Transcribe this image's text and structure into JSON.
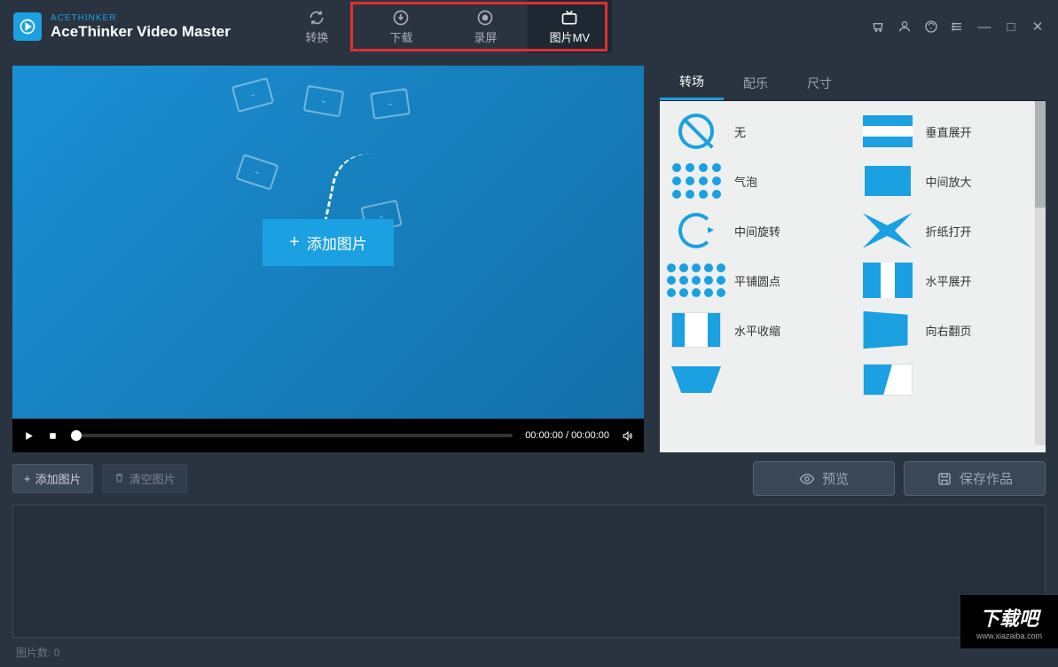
{
  "brand": {
    "top": "ACETHINKER",
    "main": "AceThinker Video Master"
  },
  "nav": {
    "convert": "转换",
    "download": "下载",
    "record": "录屏",
    "photomv": "图片MV"
  },
  "preview": {
    "add_photo": "添加图片"
  },
  "player": {
    "time": "00:00:00 / 00:00:00"
  },
  "side_tabs": {
    "transition": "转场",
    "music": "配乐",
    "size": "尺寸"
  },
  "transitions": [
    {
      "label": "无"
    },
    {
      "label": "垂直展开"
    },
    {
      "label": "气泡"
    },
    {
      "label": "中间放大"
    },
    {
      "label": "中间旋转"
    },
    {
      "label": "折纸打开"
    },
    {
      "label": "平铺圆点"
    },
    {
      "label": "水平展开"
    },
    {
      "label": "水平收缩"
    },
    {
      "label": "向右翻页"
    }
  ],
  "buttons": {
    "add_photo": "添加图片",
    "clear_photo": "清空图片",
    "preview": "预览",
    "save": "保存作品"
  },
  "footer": {
    "count_label": "图片数:",
    "count": "0"
  },
  "watermark": {
    "text": "下载吧",
    "url": "www.xiazaiba.com"
  }
}
